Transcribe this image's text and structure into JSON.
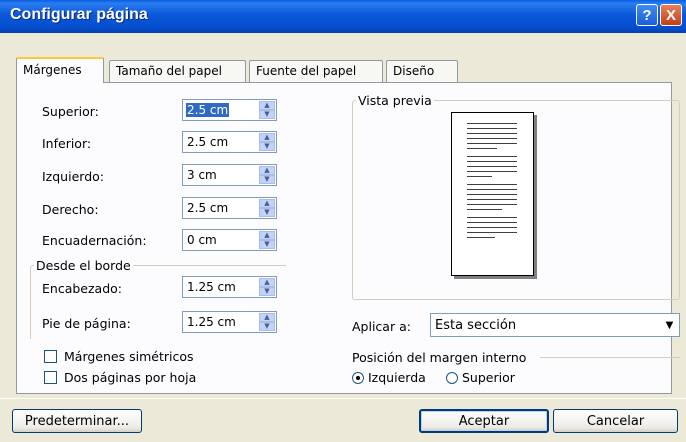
{
  "window": {
    "title": "Configurar página"
  },
  "titlebar": {
    "help_glyph": "?",
    "close_glyph": "X"
  },
  "tabs": [
    {
      "label": "Márgenes",
      "active": true
    },
    {
      "label": "Tamaño del papel",
      "active": false
    },
    {
      "label": "Fuente del papel",
      "active": false
    },
    {
      "label": "Diseño",
      "active": false
    }
  ],
  "margins": {
    "superior": {
      "label": "Superior:",
      "value": "2.5 cm"
    },
    "inferior": {
      "label": "Inferior:",
      "value": "2.5 cm"
    },
    "izquierdo": {
      "label": "Izquierdo:",
      "value": "3 cm"
    },
    "derecho": {
      "label": "Derecho:",
      "value": "2.5 cm"
    },
    "encuadernacion": {
      "label": "Encuadernación:",
      "value": "0 cm"
    }
  },
  "desde_borde": {
    "title": "Desde el borde",
    "encabezado": {
      "label": "Encabezado:",
      "value": "1.25 cm"
    },
    "pie": {
      "label": "Pie de página:",
      "value": "1.25 cm"
    }
  },
  "options": {
    "margenes_simetricos": {
      "label": "Márgenes simétricos",
      "checked": false
    },
    "dos_paginas": {
      "label": "Dos páginas por hoja",
      "checked": false
    }
  },
  "preview": {
    "title": "Vista previa"
  },
  "aplicar": {
    "label": "Aplicar a:",
    "value": "Esta sección"
  },
  "posicion": {
    "title": "Posición del margen interno",
    "izquierda": {
      "label": "Izquierda",
      "selected": true
    },
    "superior": {
      "label": "Superior",
      "selected": false
    }
  },
  "buttons": {
    "predeterminar": "Predeterminar...",
    "aceptar": "Aceptar",
    "cancelar": "Cancelar"
  },
  "colors": {
    "titlebar": "#0a5fe0",
    "dialog_bg": "#ece9d8",
    "selection": "#316ac5"
  }
}
